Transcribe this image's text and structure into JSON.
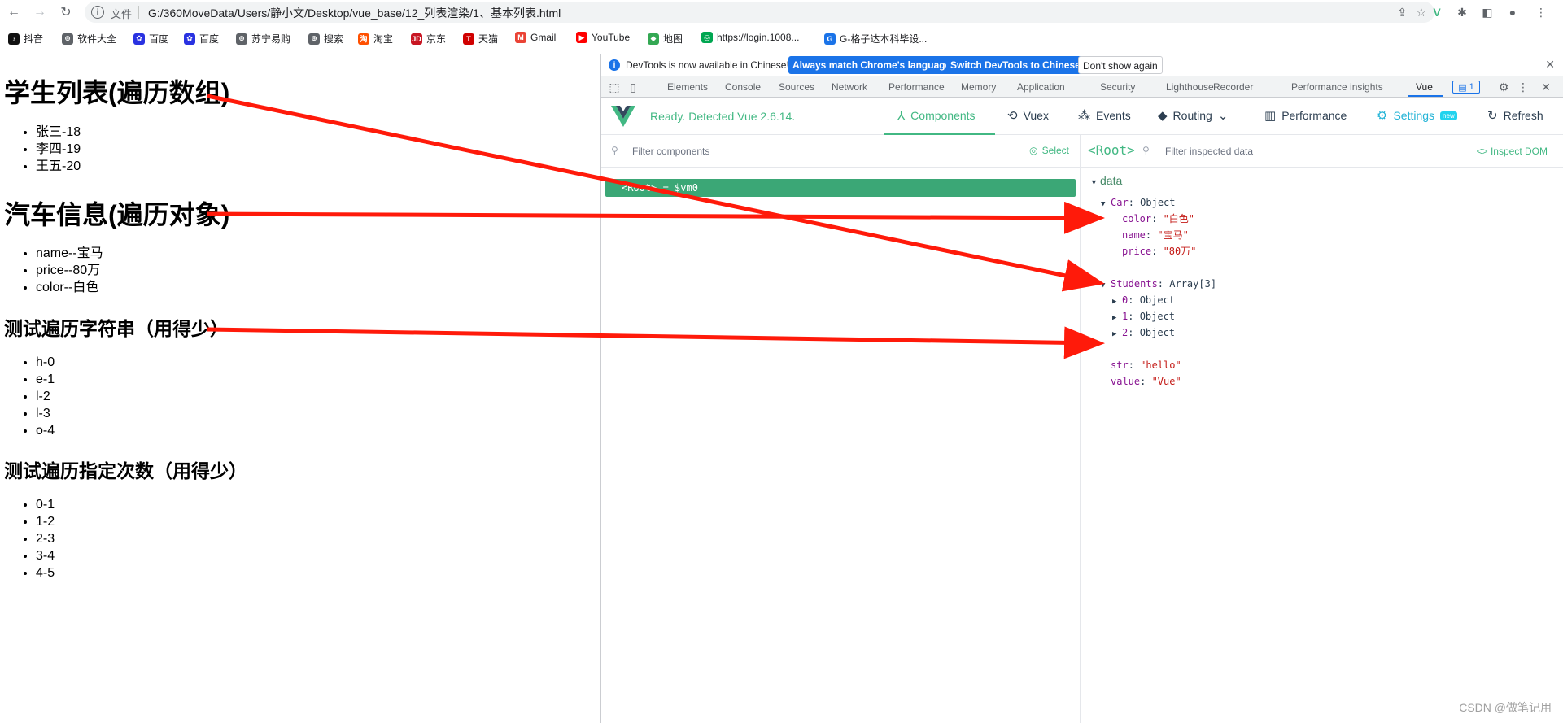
{
  "browser": {
    "nav": {
      "back_icon": "←",
      "forward_icon": "→",
      "reload_icon": "↻"
    },
    "omnibox": {
      "scheme": "文件",
      "url": "G:/360MoveData/Users/静小文/Desktop/vue_base/12_列表渲染/1、基本列表.html"
    },
    "bookmarks": [
      {
        "label": "抖音",
        "color": "#111111",
        "glyph": "♪"
      },
      {
        "label": "软件大全",
        "color": "#5f6368",
        "glyph": "⊕"
      },
      {
        "label": "百度",
        "color": "#2932e1",
        "glyph": "✿"
      },
      {
        "label": "百度",
        "color": "#2932e1",
        "glyph": "✿"
      },
      {
        "label": "苏宁易购",
        "color": "#5f6368",
        "glyph": "⊕"
      },
      {
        "label": "搜索",
        "color": "#5f6368",
        "glyph": "⊕"
      },
      {
        "label": "淘宝",
        "color": "#ff5000",
        "glyph": "淘"
      },
      {
        "label": "京东",
        "color": "#c81623",
        "glyph": "JD"
      },
      {
        "label": "天猫",
        "color": "#d00000",
        "glyph": "T"
      },
      {
        "label": "Gmail",
        "color": "#ea4335",
        "glyph": "M"
      },
      {
        "label": "YouTube",
        "color": "#ff0000",
        "glyph": "▶"
      },
      {
        "label": "地图",
        "color": "#34a853",
        "glyph": "◆"
      },
      {
        "label": "https://login.1008...",
        "color": "#00a651",
        "glyph": "◎"
      },
      {
        "label": "G-格子达本科毕设...",
        "color": "#1a73e8",
        "glyph": "G"
      }
    ]
  },
  "page": {
    "section1": {
      "title": "学生列表(遍历数组)",
      "items": [
        "张三-18",
        "李四-19",
        "王五-20"
      ]
    },
    "section2": {
      "title": "汽车信息(遍历对象)",
      "items": [
        "name--宝马",
        "price--80万",
        "color--白色"
      ]
    },
    "section3": {
      "title": "测试遍历字符串（用得少）",
      "items": [
        "h-0",
        "e-1",
        "l-2",
        "l-3",
        "o-4"
      ]
    },
    "section4": {
      "title": "测试遍历指定次数（用得少）",
      "items": [
        "0-1",
        "1-2",
        "2-3",
        "3-4",
        "4-5"
      ]
    }
  },
  "devtools": {
    "infobar": {
      "message": "DevTools is now available in Chinese!",
      "btn_match": "Always match Chrome's language",
      "btn_switch": "Switch DevTools to Chinese",
      "btn_dont": "Don't show again"
    },
    "tabs": [
      "Elements",
      "Console",
      "Sources",
      "Network",
      "Performance",
      "Memory",
      "Application",
      "Security",
      "Lighthouse",
      "Recorder",
      "Performance insights",
      "Vue"
    ],
    "active_tab": "Vue",
    "message_count": "1",
    "vue": {
      "status": "Ready. Detected Vue 2.6.14.",
      "tabs": {
        "components": "Components",
        "vuex": "Vuex",
        "events": "Events",
        "routing": "Routing",
        "performance": "Performance",
        "settings": "Settings",
        "settings_badge": "new",
        "refresh": "Refresh"
      },
      "filter_components_placeholder": "Filter components",
      "select_label": "Select",
      "root_row": "<Root> = $vm0",
      "inspected_name": "<Root>",
      "filter_data_placeholder": "Filter inspected data",
      "inspect_dom": "Inspect DOM",
      "data_section": "data",
      "car": {
        "key": "Car",
        "type": "Object",
        "fields": [
          {
            "k": "color",
            "v": "\"白色\""
          },
          {
            "k": "name",
            "v": "\"宝马\""
          },
          {
            "k": "price",
            "v": "\"80万\""
          }
        ]
      },
      "students": {
        "key": "Students",
        "type": "Array[3]",
        "items": [
          {
            "k": "0",
            "v": "Object"
          },
          {
            "k": "1",
            "v": "Object"
          },
          {
            "k": "2",
            "v": "Object"
          }
        ]
      },
      "str": {
        "k": "str",
        "v": "\"hello\""
      },
      "value": {
        "k": "value",
        "v": "\"Vue\""
      }
    }
  },
  "watermark": "CSDN @做笔记用",
  "colors": {
    "vue_green": "#42b883",
    "root_row": "#3ba776",
    "chrome_blue": "#1a73e8",
    "arrow_red": "#ff1a0a"
  }
}
